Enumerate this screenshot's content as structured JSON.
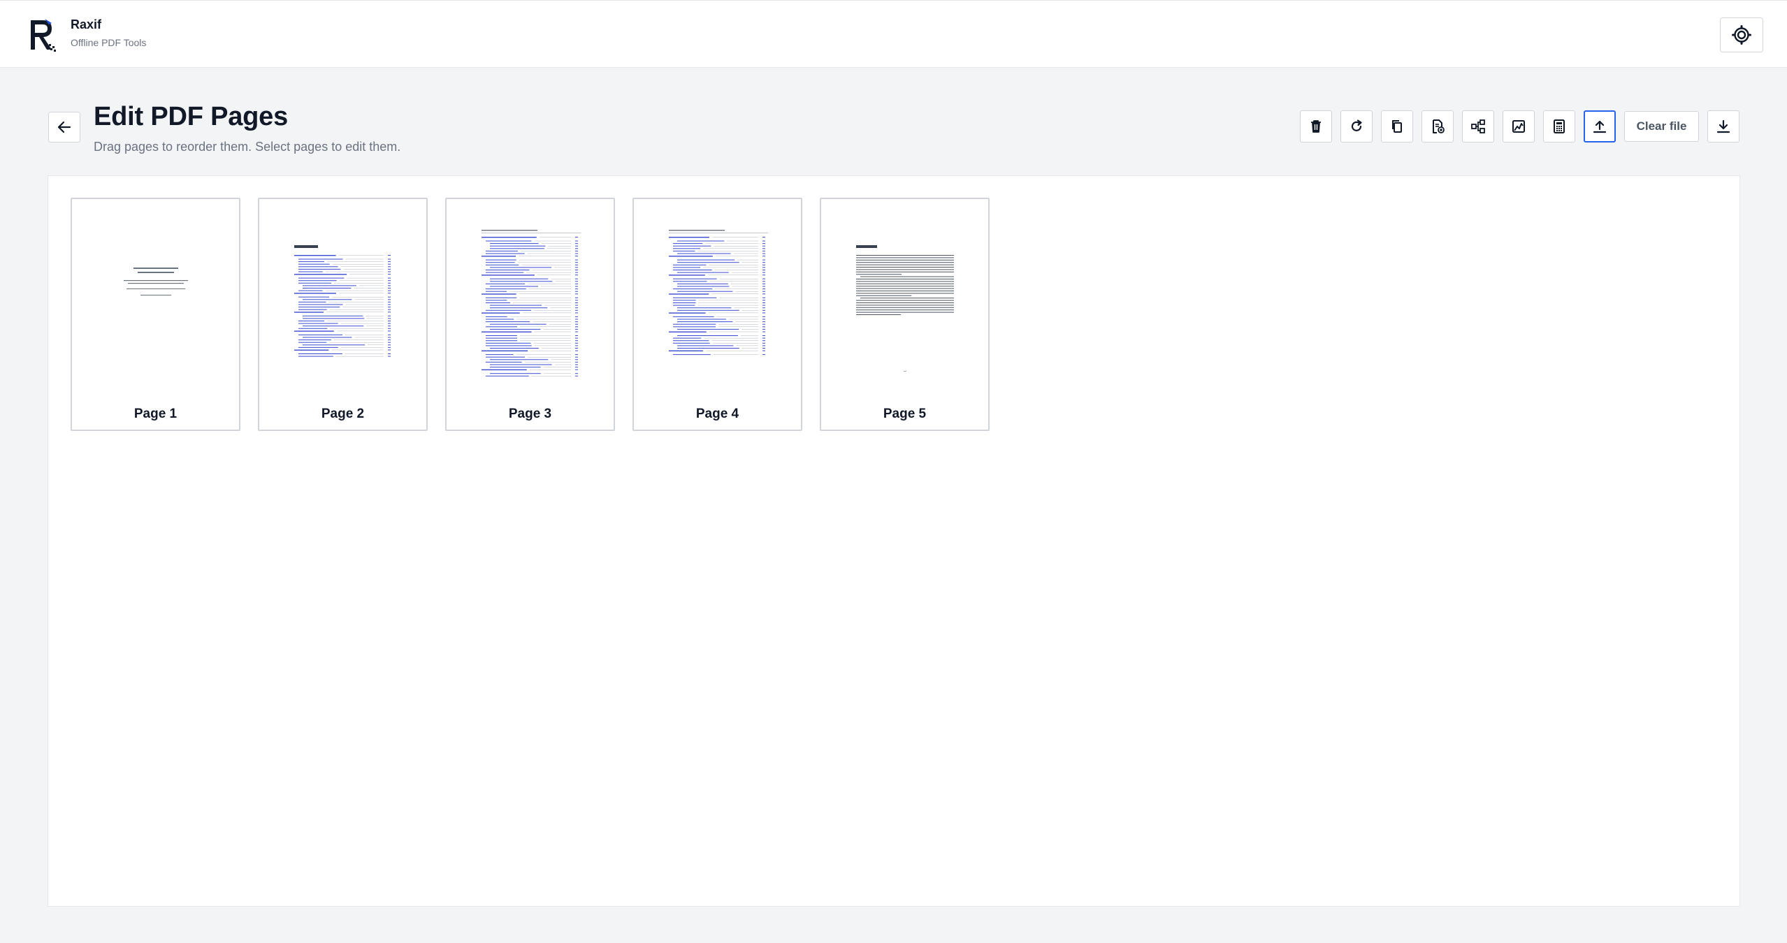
{
  "app": {
    "name": "Raxif",
    "tagline": "Offline PDF Tools"
  },
  "header": {
    "theme_icon": "sun-gear-icon"
  },
  "editor": {
    "title": "Edit PDF Pages",
    "subtitle": "Drag pages to reorder them. Select pages to edit them."
  },
  "toolbar": {
    "buttons": [
      {
        "icon": "trash-icon"
      },
      {
        "icon": "rotate-icon"
      },
      {
        "icon": "duplicate-icon"
      },
      {
        "icon": "insert-page-icon"
      },
      {
        "icon": "split-icon"
      },
      {
        "icon": "image-icon"
      },
      {
        "icon": "calculator-icon"
      },
      {
        "icon": "upload-icon"
      }
    ],
    "clear_label": "Clear file",
    "download_icon": "download-icon"
  },
  "pages": [
    {
      "label": "Page 1"
    },
    {
      "label": "Page 2"
    },
    {
      "label": "Page 3"
    },
    {
      "label": "Page 4"
    },
    {
      "label": "Page 5"
    }
  ],
  "colors": {
    "accent": "#2563eb",
    "link_blue": "#3b4bd1",
    "background": "#f3f4f6"
  }
}
